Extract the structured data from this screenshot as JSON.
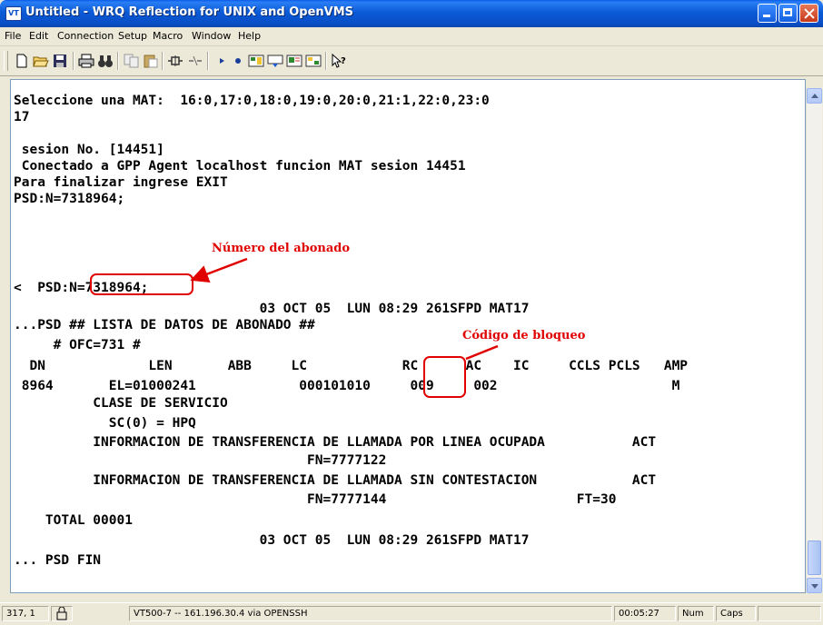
{
  "window": {
    "title": "Untitled - WRQ Reflection for UNIX and OpenVMS",
    "icon_label": "VT",
    "icon": "reflection-app-icon",
    "controls": [
      "minimize-icon",
      "maximize-icon",
      "close-icon"
    ]
  },
  "menu": {
    "items": [
      "File",
      "Edit",
      "Connection",
      "Setup",
      "Macro",
      "Window",
      "Help"
    ]
  },
  "toolbar": {
    "tools": [
      "new-document-icon",
      "open-folder-icon",
      "save-disk-icon",
      "print-icon",
      "find-binoculars-icon",
      "copy-icon",
      "paste-icon",
      "connect-icon",
      "disconnect-icon",
      "play-macro-icon",
      "record-macro-icon",
      "settings-panel-icon",
      "keyboard-map-icon",
      "display-setup-icon",
      "session-setup-icon",
      "context-help-icon"
    ]
  },
  "terminal": {
    "lines": [
      "Seleccione una MAT:  16:0,17:0,18:0,19:0,20:0,21:1,22:0,23:0",
      "17",
      "",
      " sesion No. [14451]",
      " Conectado a GPP Agent localhost funcion MAT sesion 14451",
      "Para finalizar ingrese EXIT",
      "PSD:N=7318964;",
      "",
      "",
      "<  PSD:N=7318964;",
      "                               03 OCT 05  LUN 08:29 261SFPD MAT17",
      "...PSD ## LISTA DE DATOS DE ABONADO ##",
      "     # OFC=731 #",
      "  DN             LEN       ABB     LC            RC      AC    IC     CCLS PCLS   AMP",
      " 8964       EL=01000241             000101010     009     002                      M",
      "          CLASE DE SERVICIO",
      "            SC(0) = HPQ",
      "          INFORMACION DE TRANSFERENCIA DE LLAMADA POR LINEA OCUPADA           ACT",
      "                                     FN=7777122",
      "          INFORMACION DE TRANSFERENCIA DE LLAMADA SIN CONTESTACION            ACT",
      "                                     FN=7777144                        FT=30",
      "    TOTAL 00001",
      "                               03 OCT 05  LUN 08:29 261SFPD MAT17",
      "... PSD FIN"
    ]
  },
  "annotations": {
    "subscriber_number": "Número del abonado",
    "block_code": "Código de bloqueo"
  },
  "statusbar": {
    "cursor_position": "317, 1",
    "lock_icon": "padlock-icon",
    "connection": "VT500-7 -- 161.196.30.4 via OPENSSH",
    "elapsed": "00:05:27",
    "num": "Num",
    "caps": "Caps"
  },
  "colors": {
    "titlebar": "#0a4fc7",
    "annotation": "#e00000",
    "terminal_bg": "#ffffff",
    "chrome_bg": "#ece9d8"
  }
}
